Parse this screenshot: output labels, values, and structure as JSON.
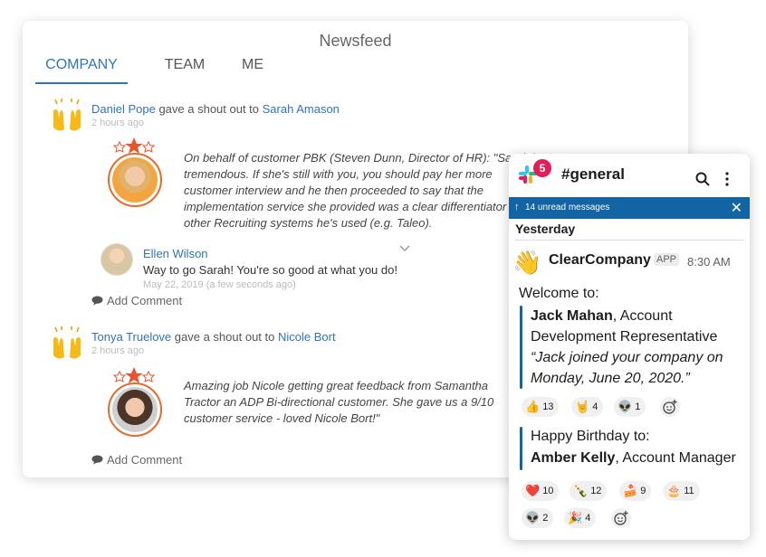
{
  "newsfeed": {
    "title": "Newsfeed",
    "tabs": [
      {
        "label": "COMPANY",
        "active": true
      },
      {
        "label": "TEAM",
        "active": false
      },
      {
        "label": "ME",
        "active": false
      }
    ],
    "posts": [
      {
        "giver": "Daniel Pope",
        "action": " gave a shout out to ",
        "receiver": "Sarah Amason",
        "time": "2 hours ago",
        "quote_lines": [
          "On behalf of customer PBK (Steven Dunn, Director of HR): \"Sarah is",
          "tremendous. If she's still with you, you should pay her more",
          "customer interview and he then proceeded to say that the",
          "implementation service she provided was a clear differentiator",
          "other Recruiting systems he's used (e.g. Taleo)."
        ],
        "comment": {
          "author": "Ellen Wilson",
          "text": "Way to go Sarah! You're so good at what you do!",
          "date": "May 22, 2019 (a few seconds ago)"
        },
        "add_comment": "Add Comment"
      },
      {
        "giver": "Tonya Truelove",
        "action": " gave a shout out to ",
        "receiver": "Nicole Bort",
        "time": "2 hours ago",
        "quote_lines": [
          "Amazing job Nicole getting great feedback from Samantha",
          "Tractor an ADP Bi-directional customer. She gave us a 9/10",
          "customer service - loved Nicole Bort!\""
        ],
        "add_comment": "Add Comment"
      }
    ]
  },
  "slack": {
    "badge": "5",
    "channel": "#general",
    "banner": "14 unread messages",
    "banner_arrow": "↑",
    "banner_close": "✕",
    "day": "Yesterday",
    "sender": "ClearCompany",
    "app_tag": "APP",
    "time": "8:30 AM",
    "wave": "👋",
    "welcome": "Welcome to:",
    "welcome_name": "Jack Mahan",
    "welcome_role_1": ", Account",
    "welcome_role_2": "Development Representative",
    "welcome_quote_1": "“Jack joined your company on",
    "welcome_quote_2": "Monday, June 20, 2020.”",
    "reactions_1": [
      {
        "emoji": "👍",
        "count": "13"
      },
      {
        "emoji": "🤘",
        "count": "4"
      },
      {
        "emoji": "👽",
        "count": "1"
      }
    ],
    "birthday": "Happy Birthday to:",
    "birthday_name": "Amber Kelly",
    "birthday_role": ", Account Manager",
    "reactions_2": [
      {
        "emoji": "❤️",
        "count": "10"
      },
      {
        "emoji": "🍾",
        "count": "12"
      },
      {
        "emoji": "🍰",
        "count": "9"
      },
      {
        "emoji": "🎂",
        "count": "11"
      }
    ],
    "reactions_3": [
      {
        "emoji": "👽",
        "count": "2"
      },
      {
        "emoji": "🎉",
        "count": "4"
      }
    ]
  },
  "colors": {
    "link": "#2f74c0",
    "slack_blue": "#1264a3",
    "badge_red": "#e01e5a",
    "ring_orange": "#e86a2c"
  }
}
